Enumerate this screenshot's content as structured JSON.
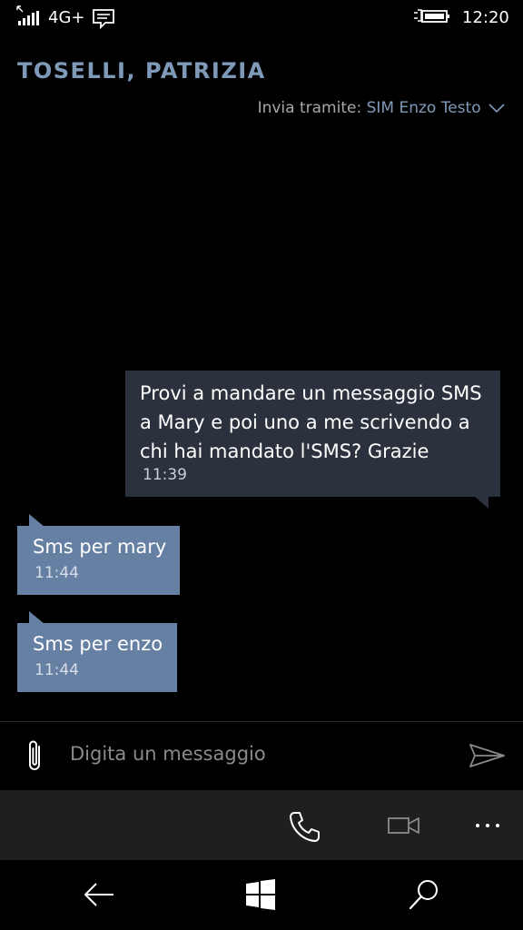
{
  "status_bar": {
    "network": "4G+",
    "time": "12:20",
    "icons": [
      "data-arrow-icon",
      "signal-icon",
      "message-notification-icon",
      "battery-charging-icon"
    ]
  },
  "header": {
    "contact_name": "TOSELLI, PATRIZIA",
    "send_via_label": "Invia tramite:",
    "send_via_value": "SIM Enzo Testo"
  },
  "messages": [
    {
      "direction": "outgoing",
      "lines": [
        "Provi a mandare un messaggio SMS",
        "a Mary e poi uno a me scrivendo a",
        "chi hai mandato l'SMS? Grazie"
      ],
      "time": "11:39"
    },
    {
      "direction": "incoming",
      "lines": [
        "Sms per mary"
      ],
      "time": "11:44"
    },
    {
      "direction": "incoming",
      "lines": [
        "Sms per enzo"
      ],
      "time": "11:44"
    }
  ],
  "composer": {
    "placeholder": "Digita un messaggio",
    "icons": [
      "attach-icon",
      "send-icon"
    ]
  },
  "app_bar": {
    "icons": [
      "phone-call-icon",
      "video-call-icon",
      "more-icon"
    ],
    "more_label": "..."
  },
  "nav_bar": {
    "icons": [
      "back-icon",
      "windows-start-icon",
      "search-icon"
    ]
  },
  "colors": {
    "accent": "#7f9ab8",
    "incoming_bubble": "#6680a3",
    "outgoing_bubble": "#2c323d",
    "app_bar": "#1f1f1f"
  }
}
